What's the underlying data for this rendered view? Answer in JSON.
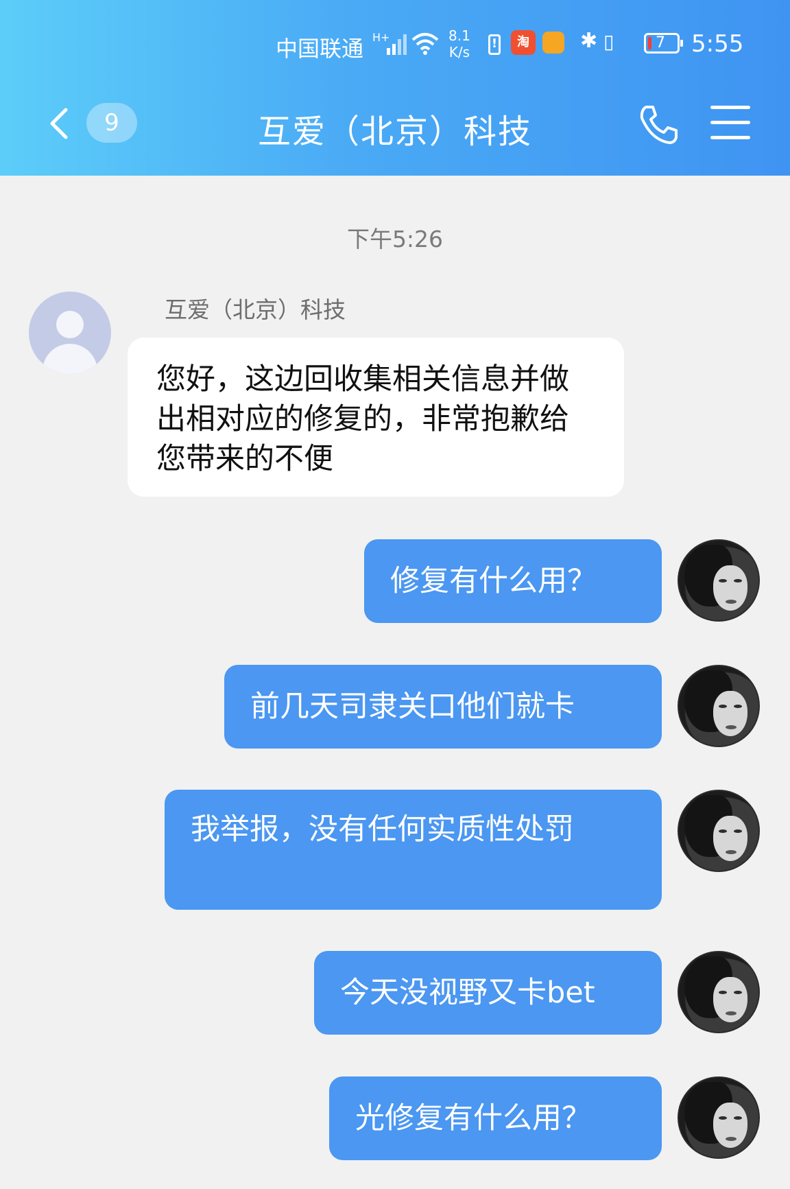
{
  "status_bar": {
    "carrier": "中国联通",
    "net_type": "H+",
    "speed_value": "8.1",
    "speed_unit": "K/s",
    "app1_icon": "taobao-icon",
    "app1_label": "淘",
    "battery": "7",
    "time": "5:55"
  },
  "nav": {
    "unread_count": "9",
    "title": "互爱（北京）科技"
  },
  "chat": {
    "timestamp": "下午5:26",
    "incoming": {
      "sender": "互爱（北京）科技",
      "text": "您好，这边回收集相关信息并做出相对应的修复的，非常抱歉给您带来的不便"
    },
    "outgoing": [
      {
        "text": "修复有什么用？"
      },
      {
        "text": "前几天司隶关口他们就卡"
      },
      {
        "text": "我举报，没有任何实质性处罚"
      },
      {
        "text": "今天没视野又卡bet"
      },
      {
        "text": "光修复有什么用？"
      }
    ]
  },
  "colors": {
    "header_start": "#5ccdf9",
    "header_end": "#3f94f2",
    "outgoing_bubble": "#4b97f1",
    "chat_background": "#f1f1f1"
  }
}
